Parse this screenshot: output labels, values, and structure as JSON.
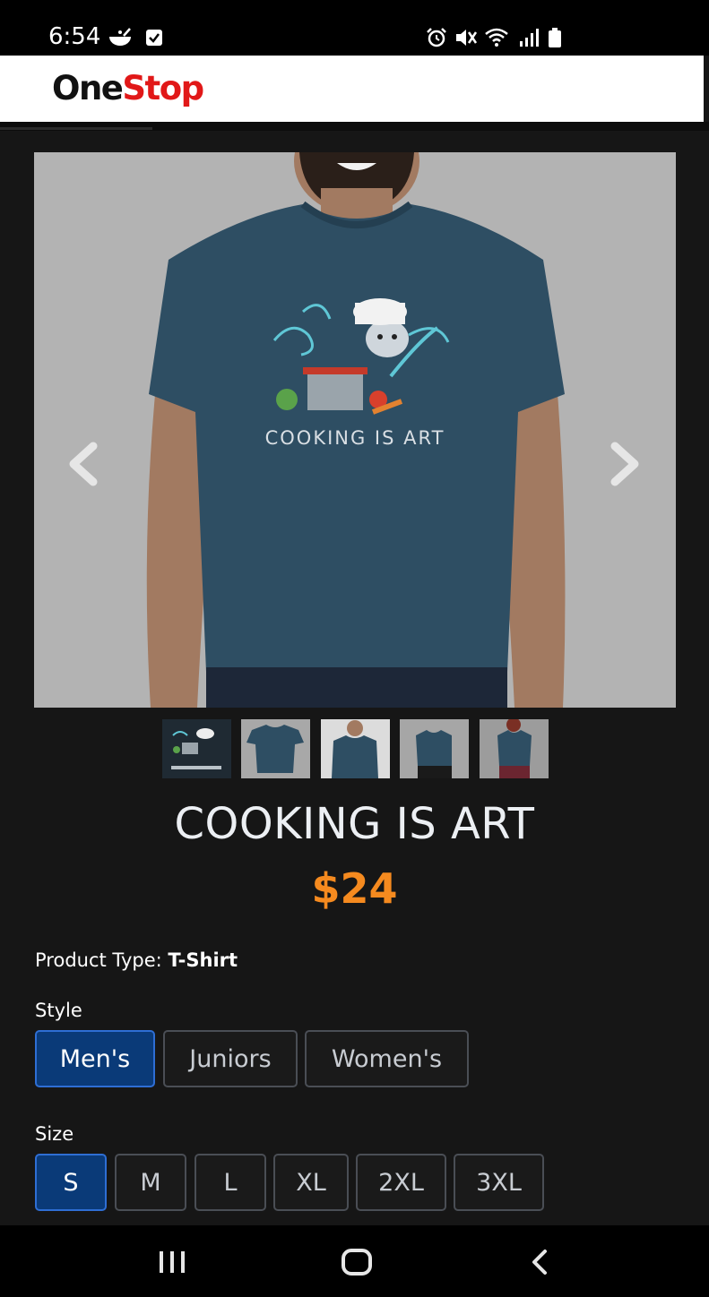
{
  "status_bar": {
    "time": "6:54",
    "left_icons": [
      "food-bowl-icon",
      "check-box-icon"
    ],
    "right_icons": [
      "alarm-icon",
      "mute-icon",
      "wifi-icon",
      "signal-icon",
      "battery-icon"
    ]
  },
  "header": {
    "logo_part1": "One",
    "logo_part2": "Stop",
    "colors": {
      "logo_dark": "#111111",
      "logo_red": "#e11818"
    }
  },
  "gallery": {
    "prev_icon": "chevron-left-icon",
    "next_icon": "chevron-right-icon",
    "thumbnail_count": 5,
    "main_image_text": "COOKING IS ART"
  },
  "product": {
    "title": "COOKING IS ART",
    "price": "$24",
    "price_color": "#f58a1f",
    "type_label": "Product Type:",
    "type_value": "T-Shirt"
  },
  "style": {
    "label": "Style",
    "options": [
      "Men's",
      "Juniors",
      "Women's"
    ],
    "selected": "Men's"
  },
  "size": {
    "label": "Size",
    "options": [
      "S",
      "M",
      "L",
      "XL",
      "2XL",
      "3XL"
    ],
    "selected": "S"
  },
  "nav_bar": {
    "icons": [
      "recent-apps-icon",
      "home-icon",
      "back-icon"
    ]
  },
  "colors": {
    "background": "#161616",
    "selected_button": "#0a3a78",
    "selected_border": "#2e6ed4"
  }
}
